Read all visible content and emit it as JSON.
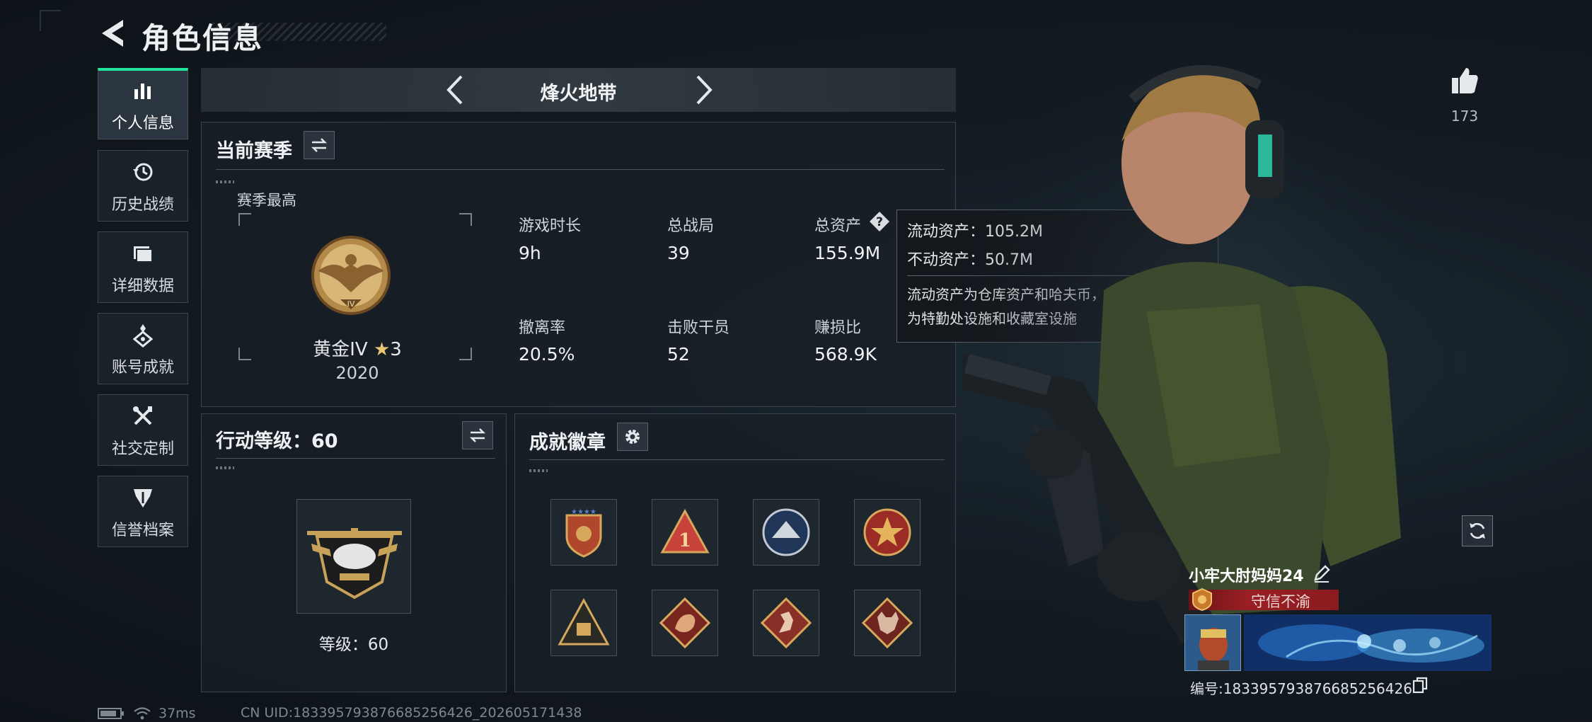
{
  "header": {
    "title": "角色信息"
  },
  "nav": {
    "items": [
      {
        "label": "个人信息",
        "icon": "bar-chart-icon",
        "active": true
      },
      {
        "label": "历史战绩",
        "icon": "history-icon",
        "active": false
      },
      {
        "label": "详细数据",
        "icon": "folder-icon",
        "active": false
      },
      {
        "label": "账号成就",
        "icon": "achievement-icon",
        "active": false
      },
      {
        "label": "社交定制",
        "icon": "tools-icon",
        "active": false
      },
      {
        "label": "信誉档案",
        "icon": "reputation-icon",
        "active": false
      }
    ]
  },
  "mode": {
    "title": "烽火地带"
  },
  "season": {
    "title": "当前赛季",
    "best_label": "赛季最高",
    "rank": "黄金IV",
    "stars": "3",
    "score": "2020",
    "stats": [
      {
        "label": "游戏时长",
        "value": "9h"
      },
      {
        "label": "总战局",
        "value": "39"
      },
      {
        "label": "总资产",
        "value": "155.9M"
      },
      {
        "label": "撤离率",
        "value": "20.5%"
      },
      {
        "label": "击败干员",
        "value": "52"
      },
      {
        "label": "赚损比",
        "value": "568.9K"
      }
    ]
  },
  "tooltip": {
    "liquid": "流动资产：105.2M",
    "fixed": "不动资产：50.7M",
    "desc_line1": "流动资产为仓库资产和哈夫币，不动资产",
    "desc_line2": "为特勤处设施和收藏室设施"
  },
  "level": {
    "title": "行动等级：60",
    "caption": "等级：60"
  },
  "badges": {
    "title": "成就徽章",
    "items": [
      "shield-stars-badge",
      "triangle-one-badge",
      "eagle-round-badge",
      "red-star-badge",
      "pyramid-badge",
      "dragon-badge",
      "runner-badge",
      "wolf-badge"
    ]
  },
  "profile": {
    "likes": "173",
    "name": "小牢大肘妈妈24",
    "title_badge": "守信不渝",
    "id_label": "编号:1833957938766852564​26"
  },
  "status": {
    "ping": "37ms",
    "uid": "CN UID:1833957938766852564​26_202605171438"
  },
  "colors": {
    "accent": "#21e39a",
    "title_badge_red": "#9a1f24",
    "gold": "#c9a25a"
  }
}
